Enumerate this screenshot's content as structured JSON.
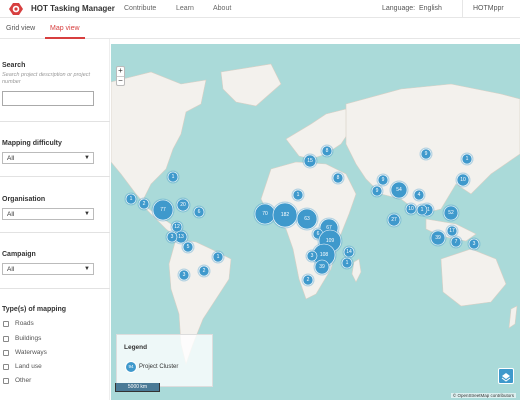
{
  "header": {
    "brand": "HOT Tasking Manager",
    "nav": [
      "Contribute",
      "Learn",
      "About"
    ],
    "language_label": "Language:",
    "language_value": "English",
    "user": "HOTMppr"
  },
  "tabs": [
    {
      "label": "Grid view",
      "active": false
    },
    {
      "label": "Map view",
      "active": true
    }
  ],
  "sidebar": {
    "search": {
      "title": "Search",
      "hint": "Search project description or project number",
      "value": ""
    },
    "mapping_difficulty": {
      "title": "Mapping difficulty",
      "selected": "All"
    },
    "organisation": {
      "title": "Organisation",
      "selected": "All"
    },
    "campaign": {
      "title": "Campaign",
      "selected": "All"
    },
    "types": {
      "title": "Type(s) of mapping",
      "options": [
        "Roads",
        "Buildings",
        "Waterways",
        "Land use",
        "Other"
      ]
    }
  },
  "map": {
    "zoom_in": "+",
    "zoom_out": "−",
    "legend_title": "Legend",
    "legend_item": "Project Cluster",
    "legend_sample": "94",
    "scale_label": "5000 km",
    "attribution": "© OpenStreetMap contributors",
    "colors": {
      "ocean": "#aadad9",
      "land": "#f3f1ed",
      "cluster": "#3f99cc"
    },
    "clusters": [
      {
        "label": "1"
      },
      {
        "label": "1"
      },
      {
        "label": "2"
      },
      {
        "label": "77"
      },
      {
        "label": "20"
      },
      {
        "label": "6"
      },
      {
        "label": "12"
      },
      {
        "label": "13"
      },
      {
        "label": "3"
      },
      {
        "label": "5"
      },
      {
        "label": "3"
      },
      {
        "label": "2"
      },
      {
        "label": "1"
      },
      {
        "label": "70"
      },
      {
        "label": "182"
      },
      {
        "label": "63"
      },
      {
        "label": "67"
      },
      {
        "label": "6"
      },
      {
        "label": "109"
      },
      {
        "label": "108"
      },
      {
        "label": "3"
      },
      {
        "label": "39"
      },
      {
        "label": "14"
      },
      {
        "label": "1"
      },
      {
        "label": "2"
      },
      {
        "label": "15"
      },
      {
        "label": "8"
      },
      {
        "label": "8"
      },
      {
        "label": "9"
      },
      {
        "label": "9"
      },
      {
        "label": "1"
      },
      {
        "label": "54"
      },
      {
        "label": "4"
      },
      {
        "label": "27"
      },
      {
        "label": "10"
      },
      {
        "label": "21"
      },
      {
        "label": "52"
      },
      {
        "label": "17"
      },
      {
        "label": "39"
      },
      {
        "label": "7"
      },
      {
        "label": "3"
      },
      {
        "label": "9"
      },
      {
        "label": "1"
      },
      {
        "label": "10"
      },
      {
        "label": "1"
      }
    ]
  }
}
